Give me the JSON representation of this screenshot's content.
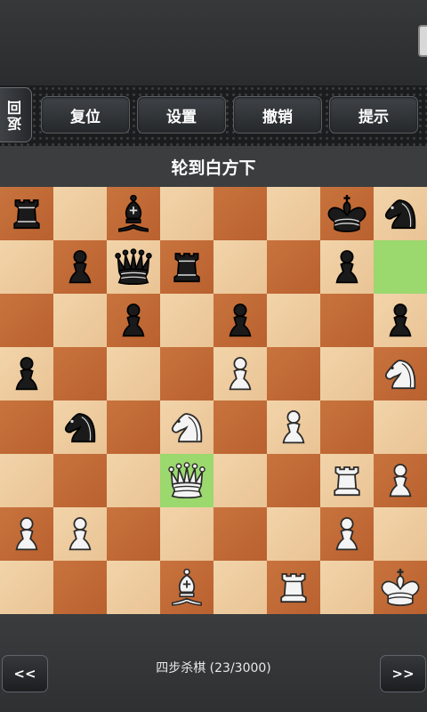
{
  "toolbar": {
    "back_label": "返回",
    "buttons": [
      "复位",
      "设置",
      "撤销",
      "提示"
    ]
  },
  "status": {
    "turn_text": "轮到白方下"
  },
  "board": {
    "files": [
      "a",
      "b",
      "c",
      "d",
      "e",
      "f",
      "g",
      "h"
    ],
    "highlighted": [
      "h7",
      "d3"
    ],
    "pieces": [
      {
        "sq": "a8",
        "color": "black",
        "type": "rook"
      },
      {
        "sq": "c8",
        "color": "black",
        "type": "bishop"
      },
      {
        "sq": "g8",
        "color": "black",
        "type": "king"
      },
      {
        "sq": "h8",
        "color": "black",
        "type": "knight"
      },
      {
        "sq": "b7",
        "color": "black",
        "type": "pawn"
      },
      {
        "sq": "c7",
        "color": "black",
        "type": "queen"
      },
      {
        "sq": "d7",
        "color": "black",
        "type": "rook"
      },
      {
        "sq": "g7",
        "color": "black",
        "type": "pawn"
      },
      {
        "sq": "c6",
        "color": "black",
        "type": "pawn"
      },
      {
        "sq": "e6",
        "color": "black",
        "type": "pawn"
      },
      {
        "sq": "h6",
        "color": "black",
        "type": "pawn"
      },
      {
        "sq": "a5",
        "color": "black",
        "type": "pawn"
      },
      {
        "sq": "e5",
        "color": "white",
        "type": "pawn"
      },
      {
        "sq": "h5",
        "color": "white",
        "type": "knight"
      },
      {
        "sq": "b4",
        "color": "black",
        "type": "knight"
      },
      {
        "sq": "d4",
        "color": "white",
        "type": "knight"
      },
      {
        "sq": "f4",
        "color": "white",
        "type": "pawn"
      },
      {
        "sq": "d3",
        "color": "white",
        "type": "queen"
      },
      {
        "sq": "g3",
        "color": "white",
        "type": "rook"
      },
      {
        "sq": "h3",
        "color": "white",
        "type": "pawn"
      },
      {
        "sq": "a2",
        "color": "white",
        "type": "pawn"
      },
      {
        "sq": "b2",
        "color": "white",
        "type": "pawn"
      },
      {
        "sq": "g2",
        "color": "white",
        "type": "pawn"
      },
      {
        "sq": "d1",
        "color": "white",
        "type": "bishop"
      },
      {
        "sq": "f1",
        "color": "white",
        "type": "rook"
      },
      {
        "sq": "h1",
        "color": "white",
        "type": "king"
      }
    ]
  },
  "footer": {
    "prev_label": "<<",
    "next_label": ">>",
    "puzzle_title": "四步杀棋 (23/3000)"
  },
  "colors": {
    "light_square": "#f2d4aa",
    "dark_square": "#c8733e",
    "highlight": "#9bd86e"
  }
}
